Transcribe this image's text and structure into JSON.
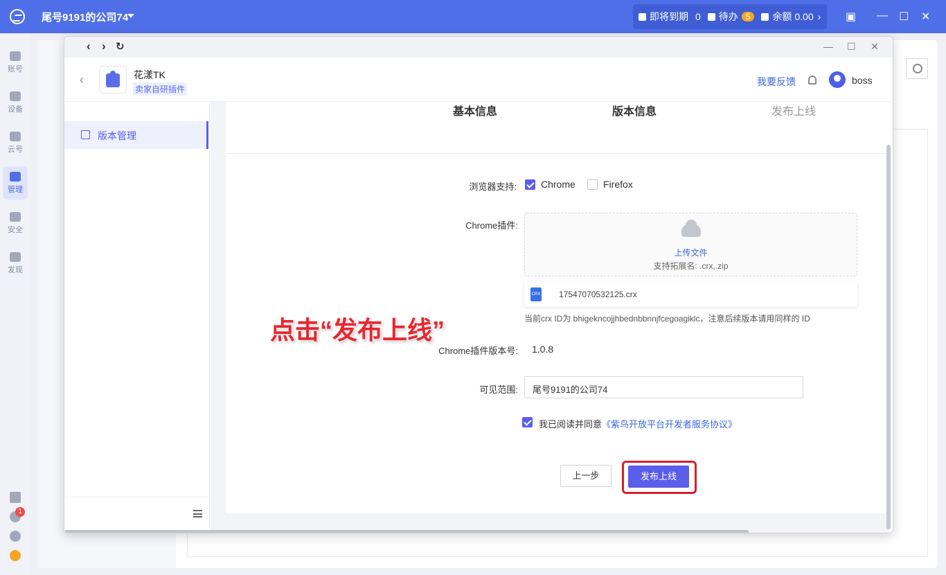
{
  "topbar": {
    "company": "尾号9191的公司74",
    "expiring_label": "即将到期",
    "expiring_count": "0",
    "todo_label": "待办",
    "todo_count": "5",
    "balance_label": "余额",
    "balance_value": "0.00"
  },
  "rail": {
    "items": [
      {
        "label": "账号",
        "icon": "store-icon"
      },
      {
        "label": "设备",
        "icon": "server-icon"
      },
      {
        "label": "云号",
        "icon": "cloud-icon"
      },
      {
        "label": "管理",
        "icon": "monitor-icon"
      },
      {
        "label": "安全",
        "icon": "shield-icon"
      },
      {
        "label": "发现",
        "icon": "compass-icon"
      }
    ],
    "notification_badge": "1"
  },
  "dialog": {
    "plugin_name": "花漾TK",
    "plugin_tag": "卖家自研插件",
    "feedback": "我要反馈",
    "username": "boss",
    "sidebar_item": "版本管理",
    "steps": [
      "基本信息",
      "版本信息",
      "发布上线"
    ]
  },
  "form": {
    "browser_support_label": "浏览器支持:",
    "chrome_option": "Chrome",
    "firefox_option": "Firefox",
    "chrome_plugin_label": "Chrome插件:",
    "upload_link": "上传文件",
    "upload_hint": "支持拓展名: .crx,.zip",
    "file_name": "17547070532125.crx",
    "file_type": "CRX",
    "crx_note": "当前crx ID为 bhigekncojjhbednbbnnjfcegoagiklc，注意后续版本请用同样的 ID",
    "version_label": "Chrome插件版本号:",
    "version_value": "1.0.8",
    "scope_label": "可见范围:",
    "scope_value": "尾号9191的公司74",
    "agree_prefix": "我已阅读并同意",
    "agree_link": "《紫鸟开放平台开发者服务协议》",
    "prev_button": "上一步",
    "publish_button": "发布上线"
  },
  "annotation": "点击“发布上线”",
  "colors": {
    "topbar": "#4f6fe8",
    "accent": "#5b5ee8",
    "highlight": "#d6202a",
    "link": "#3a67d8"
  }
}
